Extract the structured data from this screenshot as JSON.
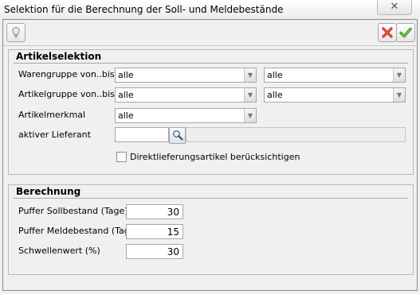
{
  "window": {
    "title": "Selektion für die Berechnung der Soll- und Meldebestände",
    "close_glyph": "✕"
  },
  "toolbar": {
    "hint_icon": "lightbulb-icon",
    "cancel_icon": "red-x-icon",
    "ok_icon": "green-check-icon"
  },
  "artikelselektion": {
    "title": "Artikelselektion",
    "warengruppe_label": "Warengruppe von..bis",
    "warengruppe_from": "alle",
    "warengruppe_to": "alle",
    "artikelgruppe_label": "Artikelgruppe von..bis",
    "artikelgruppe_from": "alle",
    "artikelgruppe_to": "alle",
    "artikelmerkmal_label": "Artikelmerkmal",
    "artikelmerkmal_value": "alle",
    "lieferant_label": "aktiver Lieferant",
    "lieferant_value": "",
    "lieferant_name": "",
    "direkt_label": "Direktlieferungsartikel berücksichtigen",
    "direkt_checked": false
  },
  "berechnung": {
    "title": "Berechnung",
    "puffer_soll_label": "Puffer Sollbestand (Tage)",
    "puffer_soll_value": "30",
    "puffer_melde_label": "Puffer Meldebestand (Tage)",
    "puffer_melde_value": "15",
    "schwelle_label": "Schwellenwert (%)",
    "schwelle_value": "30"
  }
}
